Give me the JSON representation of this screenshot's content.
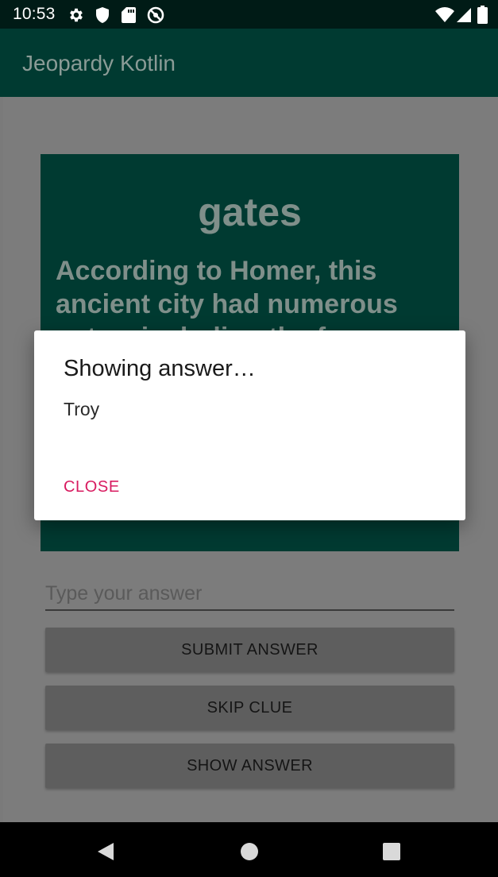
{
  "status_bar": {
    "time": "10:53",
    "icons": [
      "gear-icon",
      "shield-icon",
      "sd-card-icon",
      "at-sign-icon",
      "wifi-icon",
      "signal-icon",
      "battery-icon"
    ]
  },
  "app_bar": {
    "title": "Jeopardy Kotlin"
  },
  "clue": {
    "category": "gates",
    "question": "According to Homer, this ancient city had numerous gates, including the famous"
  },
  "answer_input": {
    "placeholder": "Type your answer",
    "value": ""
  },
  "buttons": {
    "submit": "SUBMIT ANSWER",
    "skip": "SKIP CLUE",
    "show": "SHOW ANSWER"
  },
  "dialog": {
    "title": "Showing answer…",
    "message": "Troy",
    "close_label": "CLOSE"
  },
  "nav_bar": {
    "icons": [
      "back-icon",
      "home-icon",
      "recents-icon"
    ]
  },
  "colors": {
    "primary_dark": "#001b16",
    "primary": "#003a31",
    "accent": "#d81b60",
    "scrim_background": "#7c7c7c"
  }
}
